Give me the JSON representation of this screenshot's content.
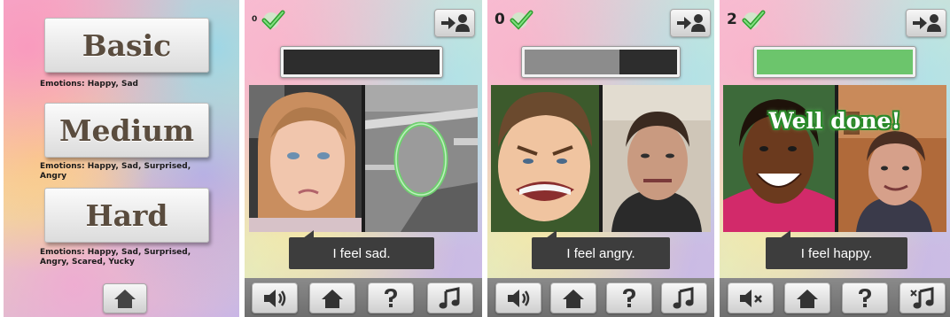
{
  "menu": {
    "levels": [
      {
        "label": "Basic",
        "description": "Emotions: Happy, Sad"
      },
      {
        "label": "Medium",
        "description": "Emotions: Happy, Sad, Surprised, Angry"
      },
      {
        "label": "Hard",
        "description": "Emotions: Happy, Sad, Surprised, Angry, Scared, Yucky"
      }
    ]
  },
  "screens": [
    {
      "score": "0",
      "caption": "I feel sad.",
      "progress": 0.0,
      "sound_on": true,
      "music_on": true
    },
    {
      "score": "0",
      "caption": "I feel angry.",
      "progress": 0.62,
      "sound_on": true,
      "music_on": true
    },
    {
      "score": "2",
      "caption": "I feel happy.",
      "progress": 1.0,
      "sound_on": false,
      "music_on": false,
      "overlay": "Well done!"
    }
  ],
  "colors": {
    "check": "#3fbf3f",
    "progress_gray": "#8c8c8c",
    "progress_green": "#6cc56c"
  },
  "icons": [
    "home-icon",
    "exit-to-user-icon",
    "speaker-icon",
    "speaker-muted-icon",
    "help-icon",
    "music-note-icon",
    "music-note-off-icon",
    "checkmark-icon",
    "mirror-oval-icon"
  ]
}
